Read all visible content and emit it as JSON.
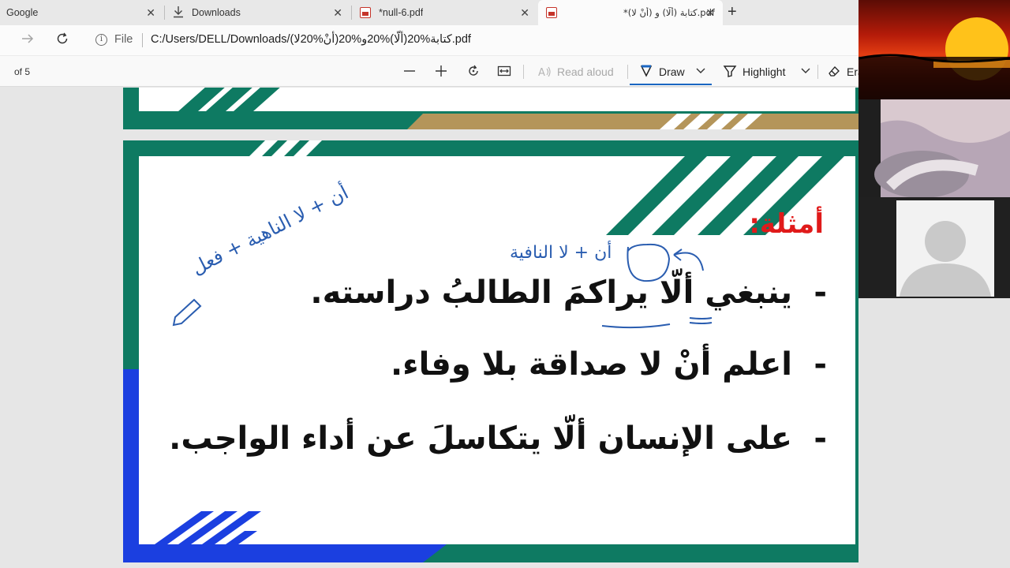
{
  "browser": {
    "tabs": [
      {
        "title": "Google",
        "close": "✕",
        "active": false,
        "icon": "google-icon"
      },
      {
        "title": "Downloads",
        "close": "✕",
        "active": false,
        "icon": "download-icon"
      },
      {
        "title": "*null-6.pdf",
        "close": "✕",
        "active": false,
        "icon": "pdf-icon"
      },
      {
        "title": "*كتابة (ألّا) و (أنْ لا).pdf",
        "close": "✕",
        "active": true,
        "icon": "pdf-icon"
      }
    ],
    "new_tab": "+",
    "address": {
      "file_label": "File",
      "url": "C:/Users/DELL/Downloads/كتابة%20(ألّا)%20و%20(أنْ%20لا).pdf"
    }
  },
  "pdf_toolbar": {
    "page_of": "of 5",
    "zoom_out": "—",
    "zoom_in": "+",
    "read_aloud": "Read aloud",
    "draw": "Draw",
    "highlight": "Highlight",
    "erase": "Era"
  },
  "slide": {
    "heading": "أمثلة:",
    "examples": [
      "ينبغي ألّا يراكمَ الطالبُ دراسته.",
      "اعلم أنْ لا صداقة بلا وفاء.",
      "على الإنسان ألّا يتكاسلَ عن أداء الواجب."
    ],
    "bullet": "-",
    "ink_notes": {
      "left_line": "أن + لا الناهية + فعل",
      "top_note": "أن + لا النافية"
    }
  },
  "colors": {
    "teal": "#0e7a62",
    "gold": "#b4955a",
    "blue": "#1b3fe0",
    "ink": "#2a5db0",
    "heading_red": "#e01a1a"
  }
}
